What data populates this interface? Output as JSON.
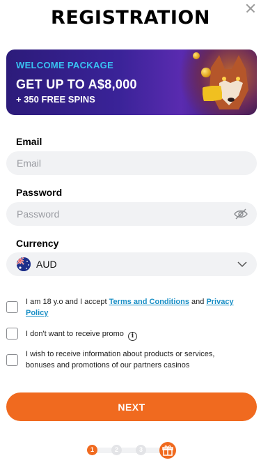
{
  "header": {
    "title": "REGISTRATION"
  },
  "banner": {
    "kicker": "WELCOME PACKAGE",
    "main": "GET UP TO A$8,000",
    "sub": "+ 350 FREE SPINS"
  },
  "form": {
    "email": {
      "label": "Email",
      "placeholder": "Email",
      "value": ""
    },
    "password": {
      "label": "Password",
      "placeholder": "Password",
      "value": "",
      "icon": "eye-slash-icon"
    },
    "currency": {
      "label": "Currency",
      "value": "AUD",
      "flag": "australia-flag-icon"
    }
  },
  "consents": [
    {
      "text_before": "I am 18 y.o and I accept ",
      "link1": "Terms and Conditions",
      "text_mid": " and ",
      "link2": "Privacy Policy",
      "checked": false
    },
    {
      "text": "I don't want to receive promo",
      "info_glyph": "i",
      "checked": false
    },
    {
      "text": "I wish to receive information about products or services, bonuses and promotions of our partners casinos",
      "checked": false
    }
  ],
  "actions": {
    "next_label": "NEXT"
  },
  "steps": {
    "items": [
      "1",
      "2",
      "3"
    ],
    "current": 1,
    "final_icon": "gift-icon"
  },
  "colors": {
    "accent": "#f06a1f",
    "link": "#1a8fc6",
    "banner_kicker": "#39c3f2",
    "field_bg": "#f1f2f4"
  }
}
